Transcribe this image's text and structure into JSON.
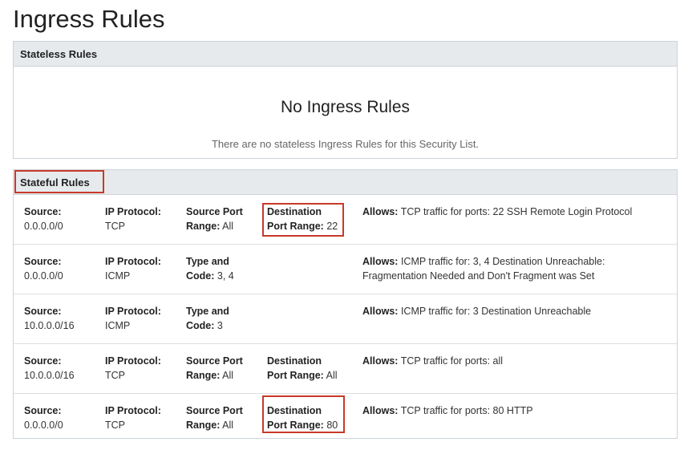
{
  "page": {
    "title": "Ingress Rules"
  },
  "stateless": {
    "header": "Stateless Rules",
    "empty_title": "No Ingress Rules",
    "empty_desc": "There are no stateless Ingress Rules for this Security List."
  },
  "stateful": {
    "header": "Stateful Rules",
    "labels": {
      "source": "Source:",
      "protocol": "IP Protocol:",
      "src_port_a": "Source Port",
      "src_port_b": "Range:",
      "dst_port_a": "Destination",
      "dst_port_b": "Port Range:",
      "type_a": "Type and",
      "type_b": "Code:",
      "allows": "Allows:"
    },
    "rules": [
      {
        "source": "0.0.0.0/0",
        "protocol": "TCP",
        "src_port": "All",
        "dst_port": "22",
        "allows": "TCP traffic for ports: 22 SSH Remote Login Protocol"
      },
      {
        "source": "0.0.0.0/0",
        "protocol": "ICMP",
        "type_code": "3, 4",
        "allows": "ICMP traffic for: 3, 4 Destination Unreachable: Fragmentation Needed and Don't Fragment was Set"
      },
      {
        "source": "10.0.0.0/16",
        "protocol": "ICMP",
        "type_code": "3",
        "allows": "ICMP traffic for: 3 Destination Unreachable"
      },
      {
        "source": "10.0.0.0/16",
        "protocol": "TCP",
        "src_port": "All",
        "dst_port": "All",
        "allows": "TCP traffic for ports: all"
      },
      {
        "source": "0.0.0.0/0",
        "protocol": "TCP",
        "src_port": "All",
        "dst_port": "80",
        "allows": "TCP traffic for ports: 80 HTTP"
      }
    ]
  },
  "colors": {
    "highlight": "#c73a2a",
    "header_bg": "#e7eaed",
    "border": "#cdd3d8"
  }
}
